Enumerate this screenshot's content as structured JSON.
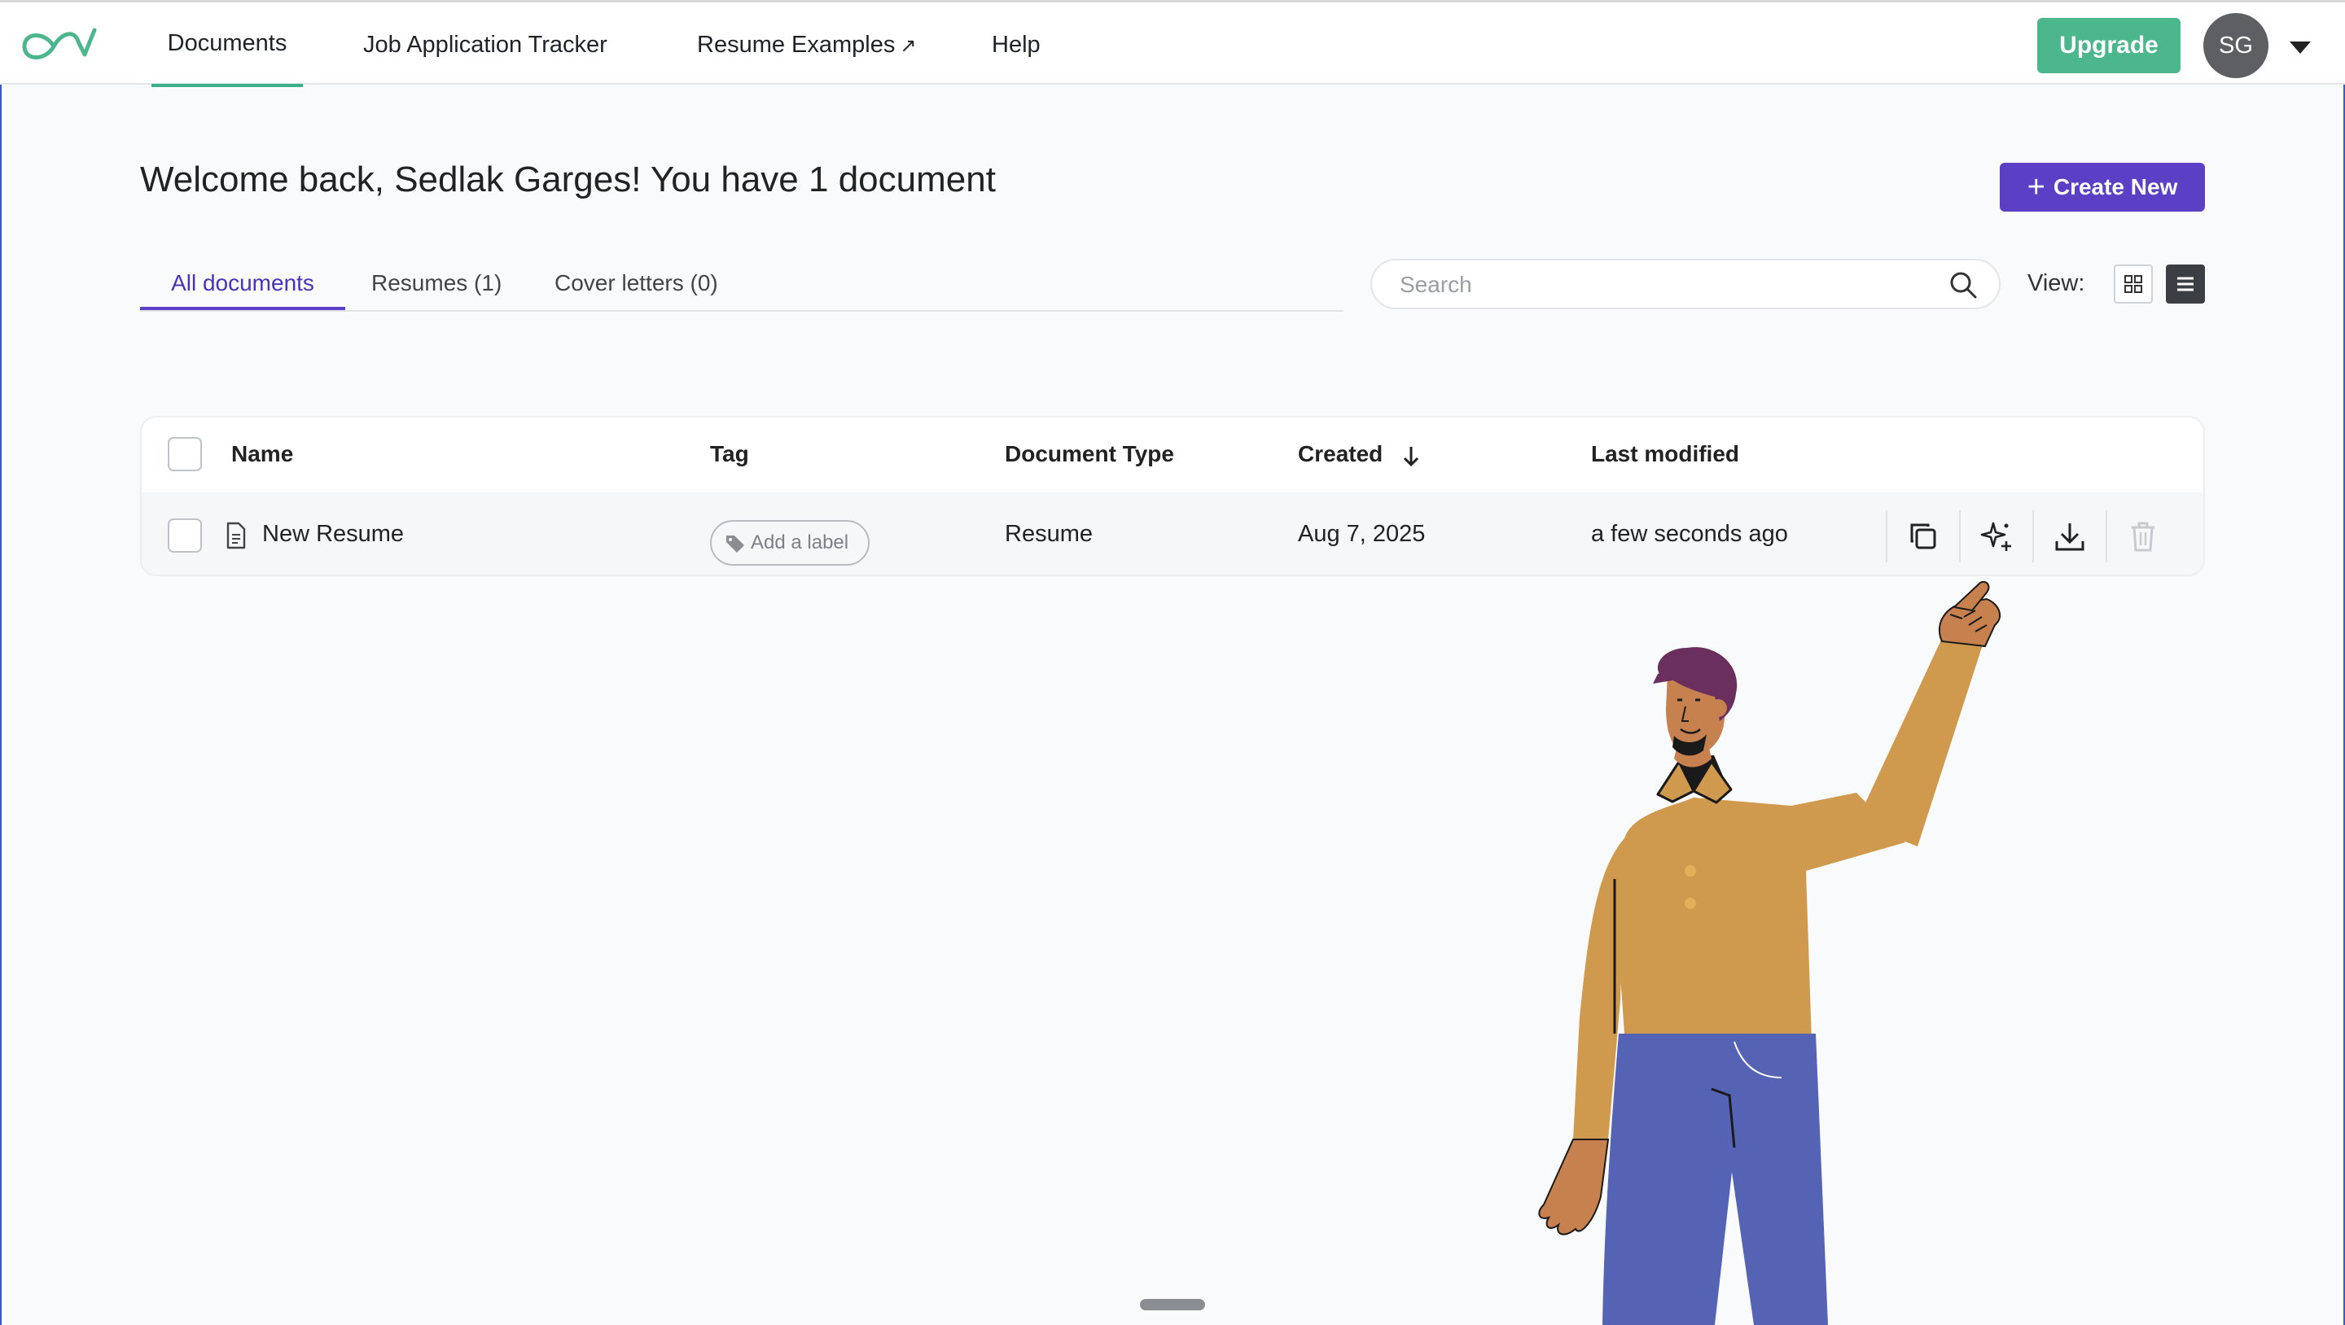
{
  "nav": {
    "items": [
      {
        "label": "Documents",
        "active": true
      },
      {
        "label": "Job Application Tracker",
        "active": false
      },
      {
        "label": "Resume Examples",
        "external_icon": "↗",
        "active": false
      },
      {
        "label": "Help",
        "active": false
      }
    ],
    "upgrade_label": "Upgrade",
    "avatar_initials": "SG"
  },
  "header": {
    "welcome": "Welcome back, Sedlak Garges! You have 1 document",
    "create_label": "Create New"
  },
  "tabs": [
    {
      "label": "All documents",
      "active": true
    },
    {
      "label": "Resumes (1)",
      "active": false
    },
    {
      "label": "Cover letters (0)",
      "active": false
    }
  ],
  "search": {
    "placeholder": "Search",
    "value": ""
  },
  "view": {
    "label": "View:",
    "selected": "list"
  },
  "table": {
    "columns": {
      "name": "Name",
      "tag": "Tag",
      "document_type": "Document Type",
      "created": "Created",
      "last_modified": "Last modified"
    },
    "sort": {
      "column": "created",
      "direction": "desc"
    },
    "rows": [
      {
        "name": "New Resume",
        "tag_label": "Add a label",
        "document_type": "Resume",
        "created": "Aug 7, 2025",
        "last_modified": "a few seconds ago"
      }
    ]
  },
  "colors": {
    "brand_green": "#4cb68d",
    "primary_purple": "#5b3fc4",
    "avatar_gray": "#5d5f63"
  },
  "icons": [
    "logo-icon",
    "external-link-icon",
    "chevron-down-icon",
    "plus-icon",
    "search-icon",
    "grid-view-icon",
    "list-view-icon",
    "sort-arrow-down-icon",
    "document-icon",
    "tag-icon",
    "duplicate-icon",
    "ai-sparkle-icon",
    "download-icon",
    "trash-icon"
  ]
}
